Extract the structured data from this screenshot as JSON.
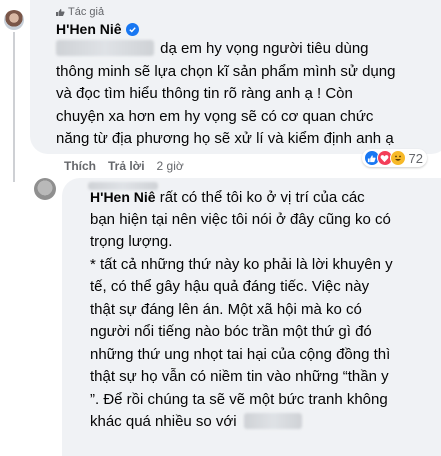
{
  "comment_1": {
    "author_tag": "Tác giả",
    "author_name": "H'Hen Niê",
    "lines": [
      "dạ em hy vọng người tiêu dùng",
      "thông minh sẽ lựa chọn kĩ sản phẩm mình sử dụng",
      "và đọc tìm hiểu thông tin rõ ràng anh ạ ! Còn",
      "chuyện xa hơn em hy vọng sẽ có cơ quan chức",
      "năng từ địa phương họ sẽ xử lí và kiểm định anh ạ"
    ],
    "like_label": "Thích",
    "reply_label": "Trả lời",
    "time": "2 giờ",
    "reaction_count": "72",
    "reaction_icons": [
      "like-icon",
      "love-icon",
      "haha-icon"
    ]
  },
  "comment_2": {
    "author_name": "H'Hen Niê",
    "first_line": "rất có thể tôi ko ở vị trí của các",
    "lines": [
      "bạn hiện tại nên việc tôi nói ở đây cũng ko có",
      "trọng lượng.",
      "* tất cả những thứ này ko phải là lời khuyên y",
      "tế, có thể gây hậu quả đáng tiếc. Việc này",
      "thật sự đáng lên án. Một xã hội mà ko có",
      "người nổi tiếng nào bóc trần một thứ gì đó",
      "những thứ ung nhọt tai hại của cộng đồng thì",
      "thật sự họ vẫn có niềm tin vào những “thần y",
      "”. Để rồi chúng ta sẽ vẽ một bức tranh không"
    ],
    "last_line": "khác quá nhiều so với"
  },
  "colors": {
    "bubble": "#f0f2f5",
    "verified": "#1877f2",
    "meta_text": "#65676b"
  }
}
